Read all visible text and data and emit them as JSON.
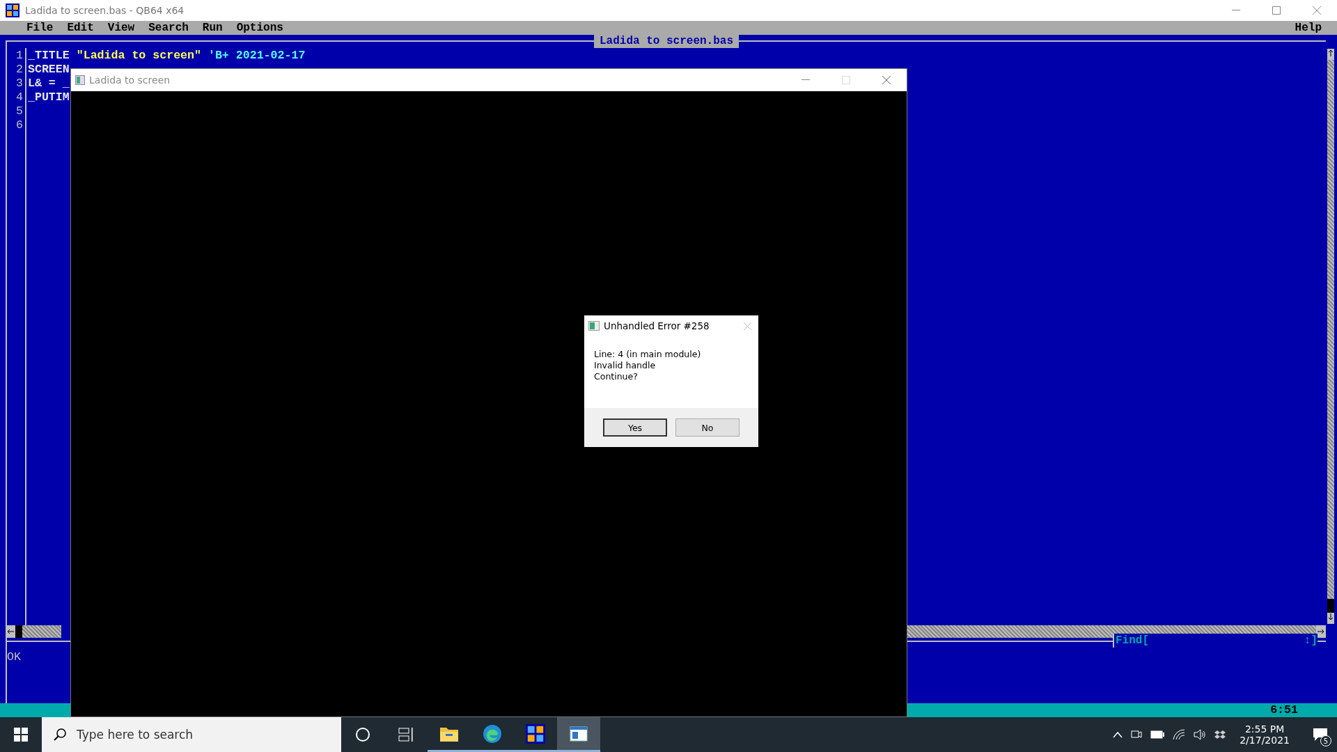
{
  "window": {
    "title": "Ladida to screen.bas - QB64 x64"
  },
  "menu": [
    {
      "label": "File"
    },
    {
      "label": "Edit"
    },
    {
      "label": "View"
    },
    {
      "label": "Search"
    },
    {
      "label": "Run"
    },
    {
      "label": "Options"
    }
  ],
  "help": "Help",
  "editor": {
    "filename": "Ladida to screen.bas",
    "lines": [
      {
        "number": "1",
        "segments": [
          {
            "kind": "plain",
            "text": "_TITLE "
          },
          {
            "kind": "string",
            "text": "\"Ladida to screen\""
          },
          {
            "kind": "comment",
            "text": " 'B+ 2021-02-17"
          }
        ]
      },
      {
        "number": "2",
        "segments": [
          {
            "kind": "plain",
            "text": "SCREEN"
          }
        ]
      },
      {
        "number": "3",
        "segments": [
          {
            "kind": "plain",
            "text": "L& = _"
          }
        ]
      },
      {
        "number": "4",
        "segments": [
          {
            "kind": "plain",
            "text": "_PUTIM"
          }
        ]
      },
      {
        "number": "5"
      },
      {
        "number": "6"
      }
    ]
  },
  "find": {
    "label": "Find[",
    "end": "↕]"
  },
  "immediate": {
    "text": "OK"
  },
  "status": {
    "position": "6:51"
  },
  "program_window": {
    "title": "Ladida to screen"
  },
  "dialog": {
    "title": "Unhandled Error #258",
    "lines": [
      "Line: 4 (in main module)",
      "Invalid handle",
      "Continue?"
    ],
    "buttons": [
      {
        "label": "Yes",
        "selected": true
      },
      {
        "label": "No",
        "selected": false
      }
    ]
  },
  "taskbar": {
    "search_placeholder": "Type here to search",
    "apps": [
      {
        "kind": "explorer",
        "active": false
      },
      {
        "kind": "edge",
        "active": false
      },
      {
        "kind": "qb64",
        "active": false
      },
      {
        "kind": "program",
        "active": true
      }
    ],
    "time": "2:55 PM",
    "date": "2/17/2021",
    "notifications": "5"
  }
}
